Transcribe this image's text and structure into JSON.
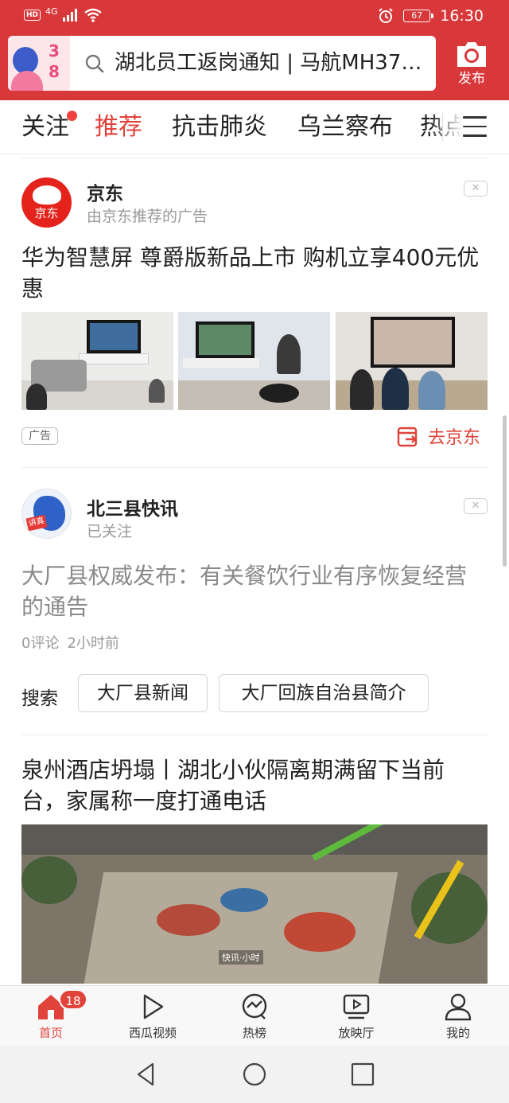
{
  "status_bar": {
    "network_badge": "HD",
    "network_type": "4G",
    "battery": "67",
    "time": "16:30"
  },
  "header": {
    "promo_number": "38",
    "search_text": "湖北员工返岗通知 | 马航MH370…",
    "publish_label": "发布"
  },
  "tabs": [
    {
      "label": "关注"
    },
    {
      "label": "推荐"
    },
    {
      "label": "抗击肺炎"
    },
    {
      "label": "乌兰察布"
    },
    {
      "label": "热点"
    }
  ],
  "feed": {
    "ad": {
      "author": "京东",
      "avatar_text": "京东",
      "subtitle": "由京东推荐的广告",
      "dismiss": "✕",
      "headline": "华为智慧屏 尊爵版新品上市 购机立享400元优惠",
      "ad_tag": "广告",
      "cta": "去京东"
    },
    "article1": {
      "author": "北三县快讯",
      "avatar_badge": "讲真",
      "subtitle": "已关注",
      "dismiss": "✕",
      "headline": "大厂县权威发布：有关餐饮行业有序恢复经营的通告",
      "comments": "0评论",
      "time": "2小时前",
      "search_label": "搜索",
      "search_chips": [
        "大厂县新闻",
        "大厂回族自治县简介"
      ]
    },
    "article2": {
      "headline": "泉州酒店坍塌丨湖北小伙隔离期满留下当前台，家属称一度打通电话",
      "watermark": "快讯·小时"
    }
  },
  "bottom_nav": [
    {
      "label": "首页",
      "badge": "18"
    },
    {
      "label": "西瓜视频"
    },
    {
      "label": "热榜"
    },
    {
      "label": "放映厅"
    },
    {
      "label": "我的"
    }
  ],
  "colors": {
    "brand_red": "#d8383a",
    "accent": "#e0433a"
  }
}
